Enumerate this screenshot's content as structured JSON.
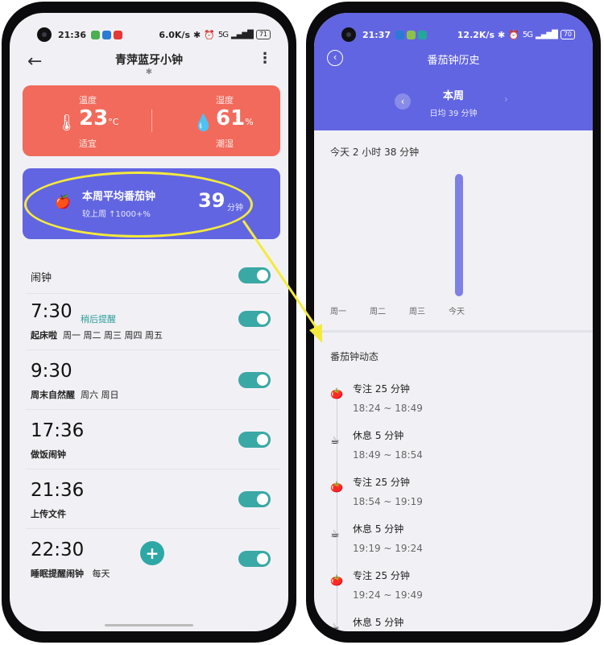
{
  "left": {
    "status": {
      "time": "21:36",
      "net": "6.0K/s",
      "signal": "5G",
      "battery": "71"
    },
    "header": {
      "title": "青萍蓝牙小钟",
      "back_icon": "←",
      "bt_icon": "✱",
      "more_icon": "⋮"
    },
    "climate": {
      "temp_label": "温度",
      "temp_value": "23",
      "temp_unit": "°C",
      "temp_status": "适宜",
      "hum_label": "湿度",
      "hum_value": "61",
      "hum_unit": "%",
      "hum_status": "潮湿",
      "temp_icon": "🌡",
      "hum_icon": "💧"
    },
    "pomodoro": {
      "title": "本周平均番茄钟",
      "sub": "较上周 ↑1000+%",
      "value": "39",
      "unit": "分钟",
      "icon": "🍎"
    },
    "alarm_header": "闹钟",
    "alarms": [
      {
        "time": "7:30",
        "snooze": "稍后提醒",
        "name": "起床啦",
        "days": "周一 周二 周三 周四 周五"
      },
      {
        "time": "9:30",
        "name": "周末自然醒",
        "days": "周六 周日"
      },
      {
        "time": "17:36",
        "name": "做饭闹钟",
        "days": ""
      },
      {
        "time": "21:36",
        "name": "上传文件",
        "days": ""
      },
      {
        "time": "22:30",
        "name": "睡眠提醒闹钟",
        "days": "每天"
      }
    ],
    "fab": "+"
  },
  "right": {
    "status": {
      "time": "21:37",
      "net": "12.2K/s",
      "signal": "5G",
      "battery": "70"
    },
    "header": {
      "title": "番茄钟历史",
      "back_icon": "‹",
      "week": "本周",
      "avg": "日均  39 分钟",
      "prev": "‹",
      "next": "›"
    },
    "today_total": "今天 2 小时 38 分钟",
    "chart_data": {
      "type": "bar",
      "categories": [
        "周一",
        "周二",
        "周三",
        "今天"
      ],
      "values": [
        0,
        0,
        0,
        158
      ],
      "ylim": [
        0,
        158
      ]
    },
    "dynamics_title": "番茄钟动态",
    "events": [
      {
        "type": "focus",
        "title": "专注 25 分钟",
        "time": "18:24 ~ 18:49"
      },
      {
        "type": "rest",
        "title": "休息 5 分钟",
        "time": "18:49 ~ 18:54"
      },
      {
        "type": "focus",
        "title": "专注 25 分钟",
        "time": "18:54 ~ 19:19"
      },
      {
        "type": "rest",
        "title": "休息 5 分钟",
        "time": "19:19 ~ 19:24"
      },
      {
        "type": "focus",
        "title": "专注 25 分钟",
        "time": "19:24 ~ 19:49"
      },
      {
        "type": "rest",
        "title": "休息 5 分钟",
        "time": ""
      }
    ]
  },
  "colors": {
    "accent_teal": "#3aa8a5",
    "pomo_purple": "#6265e2",
    "temp_red": "#f26a5b",
    "highlight_yellow": "#f4ea3c"
  }
}
